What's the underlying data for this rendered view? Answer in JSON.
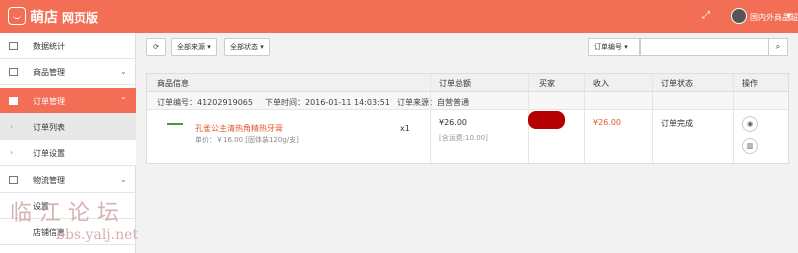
{
  "header": {
    "brand": "萌店",
    "brand_sub": "网页版",
    "store_name": "国内外商品超市",
    "accent": "#f26f55"
  },
  "sidebar": {
    "items": [
      {
        "label": "数据统计",
        "icon": "chart-icon"
      },
      {
        "label": "商品管理",
        "icon": "goods-icon"
      },
      {
        "label": "订单管理",
        "icon": "order-icon"
      },
      {
        "label": "订单列表"
      },
      {
        "label": "订单设置"
      },
      {
        "label": "物流管理",
        "icon": "truck-icon"
      },
      {
        "label": "设置"
      },
      {
        "label": "店铺信息"
      }
    ]
  },
  "toolbar": {
    "source_filter": "全部来源",
    "status_filter": "全部状态",
    "search_type": "订单编号",
    "search_value": ""
  },
  "table": {
    "headers": [
      "商品信息",
      "订单总额",
      "买家",
      "收入",
      "订单状态",
      "操作"
    ],
    "order": {
      "order_no": "订单编号：41202919065",
      "order_time": "下单时间：2016-01-11 14:03:51",
      "order_source": "订单来源：自营普通",
      "product_name": "孔雀公主清热角精热牙膏",
      "product_meta": "单价：￥16.00  [固体装120g/支]",
      "qty": "x1",
      "total": "¥26.00",
      "freight": "[含运费:10.00]",
      "income": "¥26.00",
      "status": "订单完成"
    }
  },
  "watermark": {
    "text": "临 江 论 坛",
    "url": "bbs.yalj.net"
  }
}
